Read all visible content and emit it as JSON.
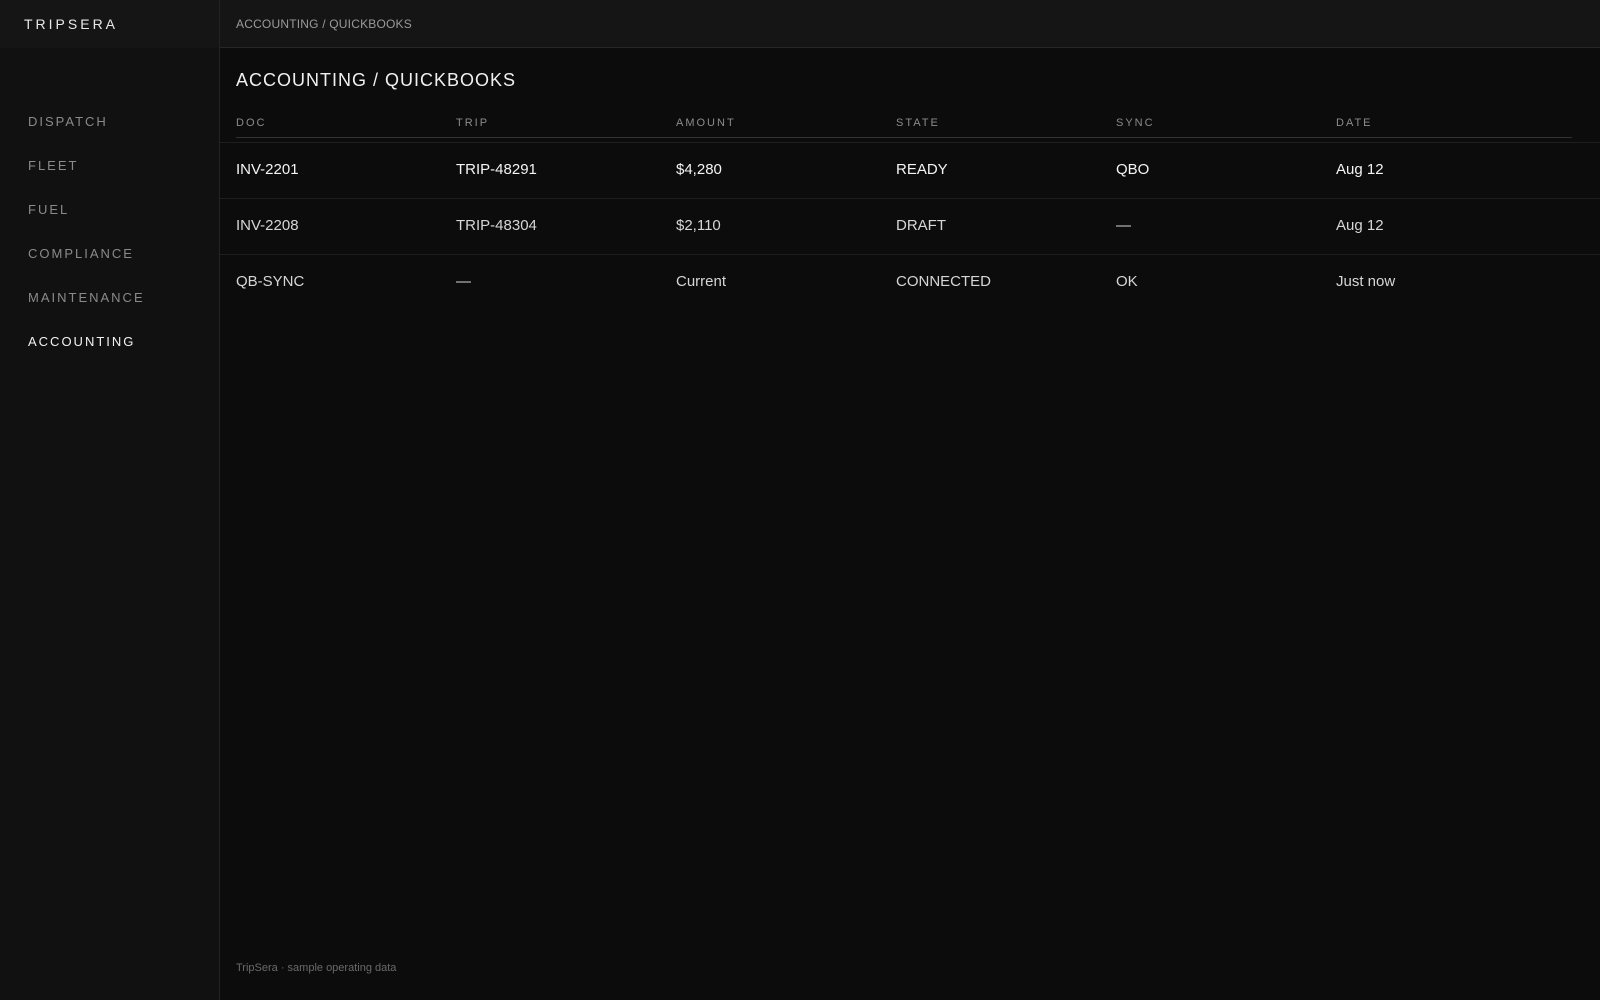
{
  "brand": "TRIPSERA",
  "breadcrumb": "ACCOUNTING / QUICKBOOKS",
  "sidebar": {
    "items": [
      {
        "label": "DISPATCH",
        "active": false
      },
      {
        "label": "FLEET",
        "active": false
      },
      {
        "label": "FUEL",
        "active": false
      },
      {
        "label": "COMPLIANCE",
        "active": false
      },
      {
        "label": "MAINTENANCE",
        "active": false
      },
      {
        "label": "ACCOUNTING",
        "active": true
      }
    ]
  },
  "page": {
    "title": "ACCOUNTING / QUICKBOOKS"
  },
  "table": {
    "columns": [
      "DOC",
      "TRIP",
      "AMOUNT",
      "STATE",
      "SYNC",
      "DATE"
    ],
    "rows": [
      [
        "INV-2201",
        "TRIP-48291",
        "$4,280",
        "READY",
        "QBO",
        "Aug 12"
      ],
      [
        "INV-2208",
        "TRIP-48304",
        "$2,110",
        "DRAFT",
        "—",
        "Aug 12"
      ],
      [
        "QB-SYNC",
        "—",
        "Current",
        "CONNECTED",
        "OK",
        "Just now"
      ]
    ]
  },
  "footer": "TripSera · sample operating data",
  "colors": {
    "background": "#0c0c0c",
    "sidebar": "#111111",
    "topbar": "#151515",
    "text_primary": "#f0f0f0",
    "text_muted": "#8a8a8a"
  }
}
